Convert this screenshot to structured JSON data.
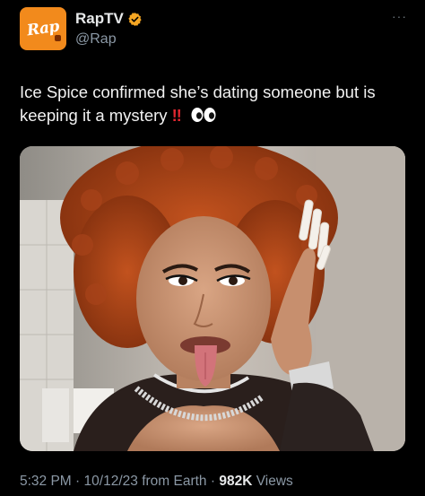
{
  "account": {
    "avatar_text": "Rap",
    "display_name": "RapTV",
    "handle": "@Rap",
    "verified": true,
    "verified_color": "#f5a623"
  },
  "more_menu": "···",
  "tweet": {
    "text": "Ice Spice confirmed she’s dating someone but is keeping it a mystery",
    "emoji_bangs": "‼",
    "emoji_eyes": "eyes-emoji"
  },
  "media": {
    "icon": "photo"
  },
  "meta": {
    "time": "5:32 PM",
    "date": "10/12/23",
    "source": "from Earth",
    "separator": "·",
    "views_count": "982K",
    "views_label": "Views"
  },
  "colors": {
    "background": "#000000",
    "avatar": "#f28a1c",
    "text": "#e7e9ea",
    "muted": "#8b98a5",
    "accent_red": "#e0262f"
  }
}
